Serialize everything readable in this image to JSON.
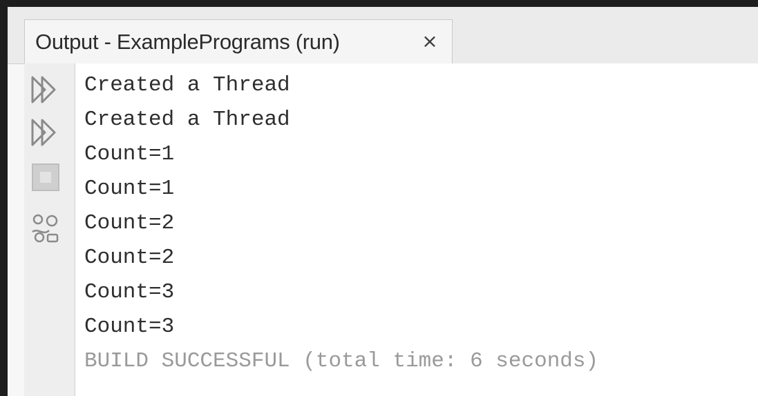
{
  "window": {
    "tab_title": "Output - ExamplePrograms (run)",
    "close_glyph": "×"
  },
  "toolbar": {
    "buttons": [
      {
        "name": "rerun-icon",
        "label": "Re-run"
      },
      {
        "name": "rerun-with-options-icon",
        "label": "Re-run with different parameters"
      },
      {
        "name": "stop-icon",
        "label": "Stop"
      },
      {
        "name": "settings-icon",
        "label": "Settings"
      }
    ]
  },
  "output": {
    "lines": [
      "Created a Thread",
      "Created a Thread",
      "Count=1",
      "Count=1",
      "Count=2",
      "Count=2",
      "Count=3",
      "Count=3"
    ],
    "status": "BUILD SUCCESSFUL (total time: 6 seconds)"
  },
  "colors": {
    "output_text": "#2e2e2e",
    "status_text": "#9a9a9a",
    "icon_stroke": "#8a8a8a"
  }
}
